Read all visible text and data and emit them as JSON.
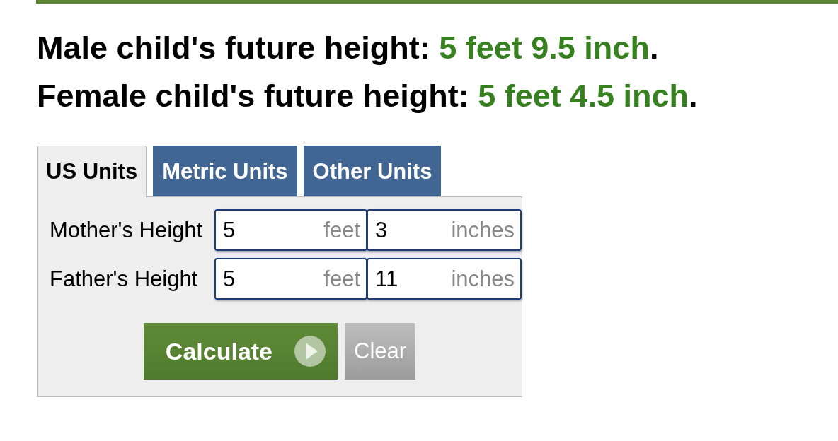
{
  "results": [
    {
      "label": "Male child's future height:",
      "value": "5 feet 9.5 inch",
      "end": "."
    },
    {
      "label": "Female child's future height:",
      "value": "5 feet 4.5 inch",
      "end": "."
    }
  ],
  "tabs": [
    {
      "label": "US Units",
      "selected": true
    },
    {
      "label": "Metric Units",
      "selected": false
    },
    {
      "label": "Other Units",
      "selected": false
    }
  ],
  "form": {
    "rows": [
      {
        "label": "Mother's Height",
        "fields": [
          {
            "value": "5",
            "unit": "feet"
          },
          {
            "value": "3",
            "unit": "inches"
          }
        ]
      },
      {
        "label": "Father's Height",
        "fields": [
          {
            "value": "5",
            "unit": "feet"
          },
          {
            "value": "11",
            "unit": "inches"
          }
        ]
      }
    ],
    "buttons": [
      {
        "kind": "primary",
        "label": "Calculate"
      },
      {
        "kind": "secondary",
        "label": "Clear"
      }
    ]
  }
}
